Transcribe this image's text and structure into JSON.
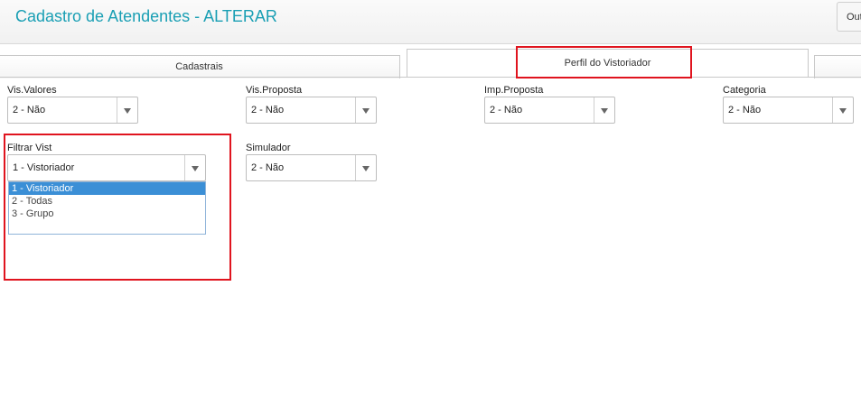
{
  "header": {
    "title": "Cadastro de Atendentes - ALTERAR",
    "outros_label": "Outros"
  },
  "tabs": [
    {
      "label": "Cadastrais"
    },
    {
      "label": "Perfil do Vistoriador"
    },
    {
      "label": ""
    }
  ],
  "fields": {
    "vis_valores": {
      "label": "Vis.Valores",
      "value": "2 - Não"
    },
    "vis_proposta": {
      "label": "Vis.Proposta",
      "value": "2 - Não"
    },
    "imp_proposta": {
      "label": "Imp.Proposta",
      "value": "2 - Não"
    },
    "categoria": {
      "label": "Categoria",
      "value": "2 - Não"
    },
    "filtrar_vist": {
      "label": "Filtrar Vist",
      "value": "1 - Vistoriador",
      "options": [
        "1 - Vistoriador",
        "2 - Todas",
        "3 - Grupo"
      ]
    },
    "simulador": {
      "label": "Simulador",
      "value": "2 - Não"
    }
  },
  "colors": {
    "title": "#1a9fb4",
    "highlight": "#e0141e",
    "selected_option": "#3b8fd6"
  }
}
